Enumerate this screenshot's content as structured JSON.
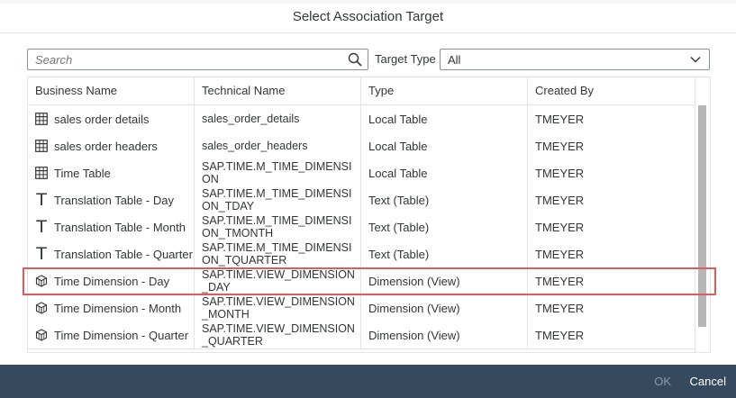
{
  "dialog": {
    "title": "Select Association Target"
  },
  "search": {
    "placeholder": "Search",
    "value": "",
    "icon": "search-icon"
  },
  "target_type": {
    "label": "Target Type",
    "value": "All"
  },
  "table": {
    "columns": [
      "Business Name",
      "Technical Name",
      "Type",
      "Created By"
    ],
    "rows": [
      {
        "icon": "table-icon",
        "business": "sales order details",
        "technical": "sales_order_details",
        "type": "Local Table",
        "created_by": "TMEYER"
      },
      {
        "icon": "table-icon",
        "business": "sales order headers",
        "technical": "sales_order_headers",
        "type": "Local Table",
        "created_by": "TMEYER"
      },
      {
        "icon": "table-icon",
        "business": "Time Table",
        "technical": "SAP.TIME.M_TIME_DIMENSION",
        "type": "Local Table",
        "created_by": "TMEYER"
      },
      {
        "icon": "text-table-icon",
        "business": "Translation Table - Day",
        "technical": "SAP.TIME.M_TIME_DIMENSION_TDAY",
        "type": "Text (Table)",
        "created_by": "TMEYER"
      },
      {
        "icon": "text-table-icon",
        "business": "Translation Table - Month",
        "technical": "SAP.TIME.M_TIME_DIMENSION_TMONTH",
        "type": "Text (Table)",
        "created_by": "TMEYER"
      },
      {
        "icon": "text-table-icon",
        "business": "Translation Table - Quarter",
        "technical": "SAP.TIME.M_TIME_DIMENSION_TQUARTER",
        "type": "Text (Table)",
        "created_by": "TMEYER"
      },
      {
        "icon": "cube-icon",
        "business": "Time Dimension - Day",
        "technical": "SAP.TIME.VIEW_DIMENSION_DAY",
        "type": "Dimension (View)",
        "created_by": "TMEYER"
      },
      {
        "icon": "cube-icon",
        "business": "Time Dimension - Month",
        "technical": "SAP.TIME.VIEW_DIMENSION_MONTH",
        "type": "Dimension (View)",
        "created_by": "TMEYER"
      },
      {
        "icon": "cube-icon",
        "business": "Time Dimension - Quarter",
        "technical": "SAP.TIME.VIEW_DIMENSION_QUARTER",
        "type": "Dimension (View)",
        "created_by": "TMEYER"
      }
    ]
  },
  "footer": {
    "ok_label": "OK",
    "cancel_label": "Cancel"
  },
  "colors": {
    "footer_bg": "#354a5f",
    "highlight": "#e15b5b"
  }
}
